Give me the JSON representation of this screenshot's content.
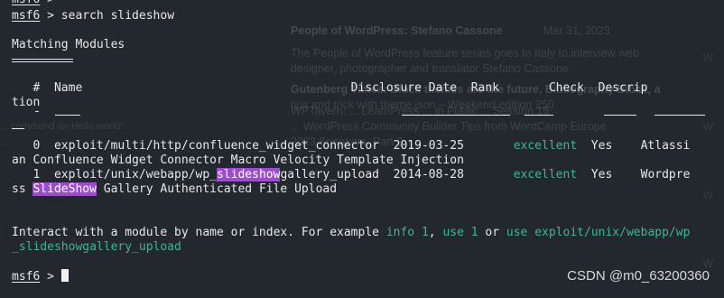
{
  "background_ghost": {
    "lines": [
      "People of WordPress: Stefano Cassone",
      "The People of WordPress feature series goes to Italy to interview web",
      "designer, photographer and translator Stefano Cassone.",
      "",
      "",
      "Gutenberg Times: Block themes are the future, Bibliography Block, a",
      "tips and trick with theme.json – Weekend edition 250",
      "",
      "",
      "",
      "WPTavern: ... LearnPress ... in Public ... Session 18",
      "... WordPress Community Builder Tips from WordCamp Europe",
      "2023 Speakers, Part 2"
    ],
    "date": "Mar 31, 2023",
    "left_fragment": "... commend an Hello world!",
    "left_fragment2": "...",
    "gutter": [
      "W",
      "W",
      "W",
      "W"
    ]
  },
  "terminal": {
    "line_prev_prompt": "msf6",
    "line_prev_gt": " >",
    "cmd_prompt": "msf6",
    "cmd_text": " > search slideshow",
    "heading": "Matching Modules",
    "header_row": "   #  Name                                      Disclosure Date  Rank       Check  Descrip",
    "header_wrap": "tion",
    "dash_num": "-",
    "row0_line1": "   0  exploit/multi/http/confluence_widget_connector  2019-03-25       ",
    "row0_rank": "excellent",
    "row0_rest": "  Yes    Atlassi",
    "row0_line2": "an Confluence Widget Connector Macro Velocity Template Injection",
    "row1_pre": "   1  exploit/unix/webapp/wp_",
    "row1_hl": "slideshow",
    "row1_post": "gallery_upload  2014-08-28       ",
    "row1_rank": "excellent",
    "row1_rest": "  Yes    Wordpre",
    "row1_line2_pre": "ss ",
    "row1_line2_hl": "SlideShow",
    "row1_line2_post": " Gallery Authenticated File Upload",
    "interact_pre": "Interact with a module by name or index. For example ",
    "interact_ex1": "info 1",
    "interact_sep1": ", ",
    "interact_ex2": "use 1",
    "interact_sep2": " or ",
    "interact_ex3": "use exploit/unix/webapp/wp",
    "interact_wrap": "_slideshowgallery_upload",
    "final_prompt": "msf6",
    "final_gt": " > "
  },
  "watermark": "CSDN @m0_63200360",
  "colors": {
    "background": "#23272e",
    "green": "#3fb690",
    "highlight": "#9b4dca",
    "text": "#e8e8e8"
  }
}
